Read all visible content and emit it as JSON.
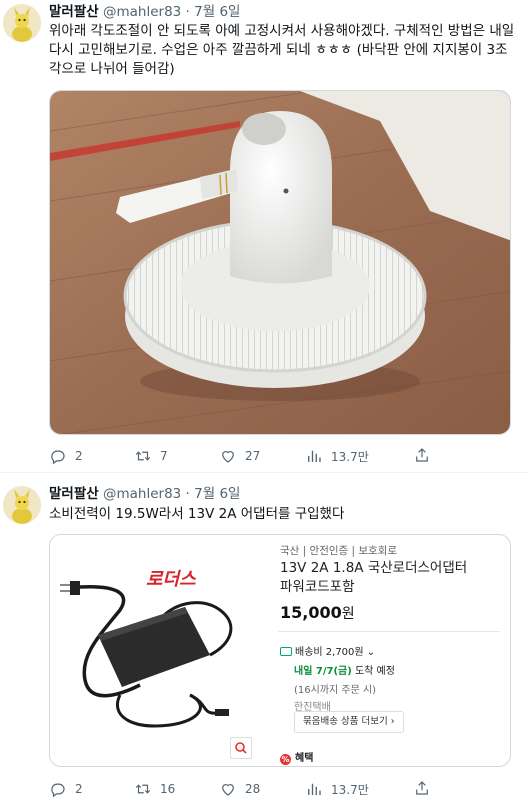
{
  "colors": {
    "text_primary": "#0f1419",
    "text_secondary": "#536471",
    "border": "#cfd9de",
    "price_green": "#0a8f3a",
    "benefit_red": "#e8322e"
  },
  "tweets": [
    {
      "author_name": "말러팔산",
      "handle": "@mahler83",
      "dot": "·",
      "date": "7월 6일",
      "text": "위아래 각도조절이 안 되도록 아예 고정시켜서 사용해야겠다. 구체적인 방법은 내일 다시 고민해보기로. 수업은 아주 깔끔하게 되네 ㅎㅎㅎ (바닥판 안에 지지봉이 3조각으로 나뉘어 들어감)",
      "media": "photo-fan",
      "replies": "2",
      "retweets": "7",
      "likes": "27",
      "views": "13.7만",
      "icons": [
        "reply-icon",
        "retweet-icon",
        "like-icon",
        "views-icon",
        "share-icon"
      ]
    },
    {
      "author_name": "말러팔산",
      "handle": "@mahler83",
      "dot": "·",
      "date": "7월 6일",
      "text": "소비전력이 19.5W라서 13V 2A 어댑터를 구입했다",
      "media": "product-card",
      "replies": "2",
      "retweets": "16",
      "likes": "28",
      "views": "13.7만",
      "icons": [
        "reply-icon",
        "retweet-icon",
        "like-icon",
        "views-icon",
        "share-icon"
      ]
    }
  ],
  "product": {
    "brand_logo_text": "로더스",
    "category": "국산 | 안전인증 | 보호회로",
    "title": "13V 2A 1.8A 국산로더스어댑터 파워코드포함",
    "price": "15,000",
    "price_unit": "원",
    "shipping": "배송비 2,700원",
    "shipping_chevron": "⌄",
    "arrival_date": "내일 7/7(금)",
    "arrival_suffix": " 도착 예정",
    "arrival_sub": "(16시까지 주문 시)",
    "courier": "한진택배",
    "bundle_button": "묶음배송 상품 더보기",
    "bundle_chevron": "›",
    "benefit_icon": "%",
    "benefit": "혜택"
  }
}
